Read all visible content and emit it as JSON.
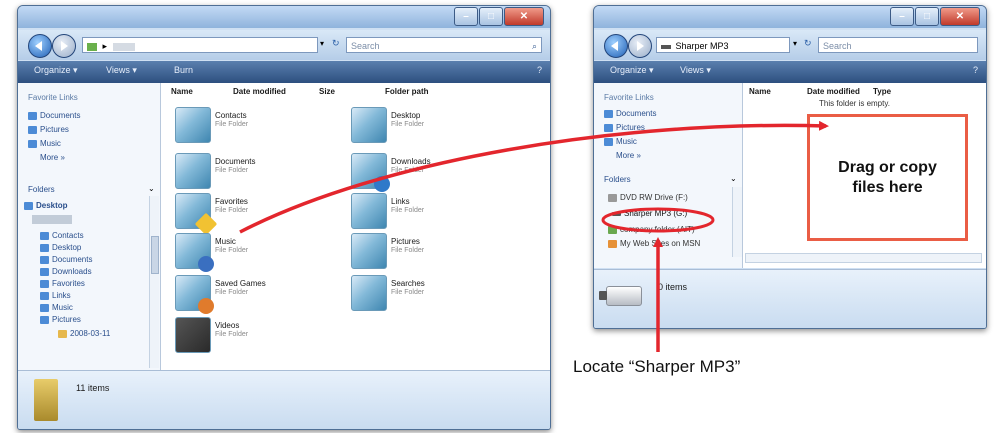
{
  "left_window": {
    "address_path": "▸",
    "search_placeholder": "Search",
    "toolbar": [
      "Organize ▾",
      "Views ▾",
      "Burn"
    ],
    "columns": [
      "Name",
      "Date modified",
      "Size",
      "Folder path"
    ],
    "favorite_links_header": "Favorite Links",
    "favorite_links": [
      "Documents",
      "Pictures",
      "Music"
    ],
    "more": "More »",
    "folders_header": "Folders",
    "tree": [
      "Desktop",
      "Contacts",
      "Desktop",
      "Documents",
      "Downloads",
      "Favorites",
      "Links",
      "Music",
      "Pictures",
      "2008-03-11"
    ],
    "items": [
      {
        "name": "Contacts",
        "type": "File Folder"
      },
      {
        "name": "Desktop",
        "type": "File Folder"
      },
      {
        "name": "Documents",
        "type": "File Folder"
      },
      {
        "name": "Downloads",
        "type": "File Folder"
      },
      {
        "name": "Favorites",
        "type": "File Folder"
      },
      {
        "name": "Links",
        "type": "File Folder"
      },
      {
        "name": "Music",
        "type": "File Folder"
      },
      {
        "name": "Pictures",
        "type": "File Folder"
      },
      {
        "name": "Saved Games",
        "type": "File Folder"
      },
      {
        "name": "Searches",
        "type": "File Folder"
      },
      {
        "name": "Videos",
        "type": "File Folder"
      }
    ],
    "status": "11 items"
  },
  "right_window": {
    "address_path": "Sharper MP3",
    "search_placeholder": "Search",
    "toolbar": [
      "Organize ▾",
      "Views ▾"
    ],
    "columns": [
      "Name",
      "Date modified",
      "Type"
    ],
    "empty_text": "This folder is empty.",
    "favorite_links_header": "Favorite Links",
    "favorite_links": [
      "Documents",
      "Pictures",
      "Music"
    ],
    "more": "More »",
    "folders_header": "Folders",
    "tree": [
      "DVD RW Drive (F:)",
      "Sharper MP3 (G:)",
      "company folder (AIT)",
      "My Web Sites on MSN"
    ],
    "status": "0 items"
  },
  "annotations": {
    "drag_box_line1": "Drag or copy",
    "drag_box_line2": "files here",
    "locate_label": "Locate “Sharper MP3”"
  },
  "colors": {
    "arrow": "#e3262d",
    "annotation_box_border": "#ea5d45"
  }
}
